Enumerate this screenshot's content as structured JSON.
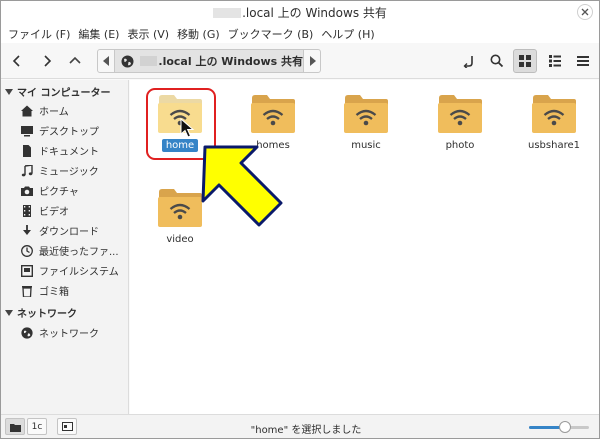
{
  "window": {
    "title": ".local 上の Windows 共有"
  },
  "menubar": {
    "items": [
      "ファイル (F)",
      "編集 (E)",
      "表示 (V)",
      "移動 (G)",
      "ブックマーク (B)",
      "ヘルプ (H)"
    ]
  },
  "toolbar": {
    "back_icon": "chevron-left-icon",
    "forward_icon": "chevron-right-icon",
    "up_icon": "chevron-up-icon",
    "path_label": ".local 上の Windows 共有",
    "path_icon": "network-globe-icon",
    "right_icons": [
      "open-terminal-icon",
      "search-icon",
      "grid-view-icon",
      "list-view-icon",
      "compact-view-icon"
    ]
  },
  "sidebar": {
    "sections": [
      {
        "title": "マイ コンピューター",
        "items": [
          {
            "label": "ホーム",
            "icon": "home-icon"
          },
          {
            "label": "デスクトップ",
            "icon": "desktop-icon"
          },
          {
            "label": "ドキュメント",
            "icon": "document-icon"
          },
          {
            "label": "ミュージック",
            "icon": "music-icon"
          },
          {
            "label": "ピクチャ",
            "icon": "camera-icon"
          },
          {
            "label": "ビデオ",
            "icon": "film-icon"
          },
          {
            "label": "ダウンロード",
            "icon": "download-icon"
          },
          {
            "label": "最近使ったファ...",
            "icon": "recent-icon"
          },
          {
            "label": "ファイルシステム",
            "icon": "drive-icon"
          },
          {
            "label": "ゴミ箱",
            "icon": "trash-icon"
          }
        ]
      },
      {
        "title": "ネットワーク",
        "items": [
          {
            "label": "ネットワーク",
            "icon": "network-icon"
          }
        ]
      }
    ]
  },
  "files": [
    {
      "name": "home",
      "selected": true
    },
    {
      "name": "homes",
      "selected": false
    },
    {
      "name": "music",
      "selected": false
    },
    {
      "name": "photo",
      "selected": false
    },
    {
      "name": "usbshare1",
      "selected": false
    },
    {
      "name": "video",
      "selected": false
    }
  ],
  "statusbar": {
    "places_icon": "places-icon",
    "tree_label": "1c",
    "toggle_sidebar_icon": "sidebar-toggle-icon",
    "status_text": "\"home\" を選択しました",
    "zoom_level": 0.6
  },
  "colors": {
    "selection": "#3584c7",
    "folder": "#f0bd5c",
    "highlight_box": "#e02020",
    "arrow_fill": "#ffff00"
  }
}
